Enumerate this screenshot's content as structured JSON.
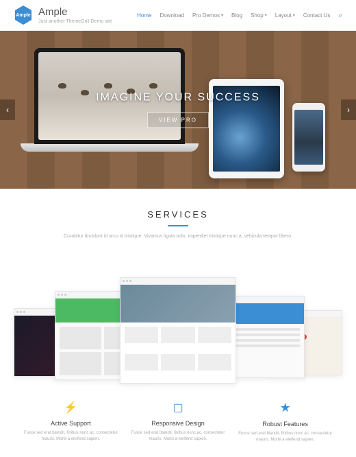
{
  "header": {
    "logo_badge": "Ample",
    "logo_text": "Ample",
    "logo_sub": "Just another ThemeGrill Demo site",
    "nav": [
      "Home",
      "Download",
      "Pro Demos",
      "Blog",
      "Shop",
      "Layout",
      "Contact Us"
    ],
    "search_icon": "search-icon"
  },
  "hero": {
    "title": "IMAGINE YOUR SUCCESS",
    "button": "VIEW PRO"
  },
  "services": {
    "title": "SERVICES",
    "sub": "Curabitur tincidunt id arcu id tristique. Vivamus ligula odio, imperdiet tristique nunc a, vehicula tempor libero."
  },
  "features": [
    {
      "icon": "bolt",
      "title": "Active Support",
      "desc": "Fusce sed erat blandit, finibus nunc ac, consectetur mauris. Morbi a eleifend sapien."
    },
    {
      "icon": "mobile",
      "title": "Responsive Design",
      "desc": "Fusce sed erat blandit, finibus nunc ac, consectetur mauris. Morbi a eleifend sapien."
    },
    {
      "icon": "star",
      "title": "Robust Features",
      "desc": "Fusce sed erat blandit, finibus nunc ac, consectetur mauris. Morbi a eleifend sapien."
    }
  ]
}
